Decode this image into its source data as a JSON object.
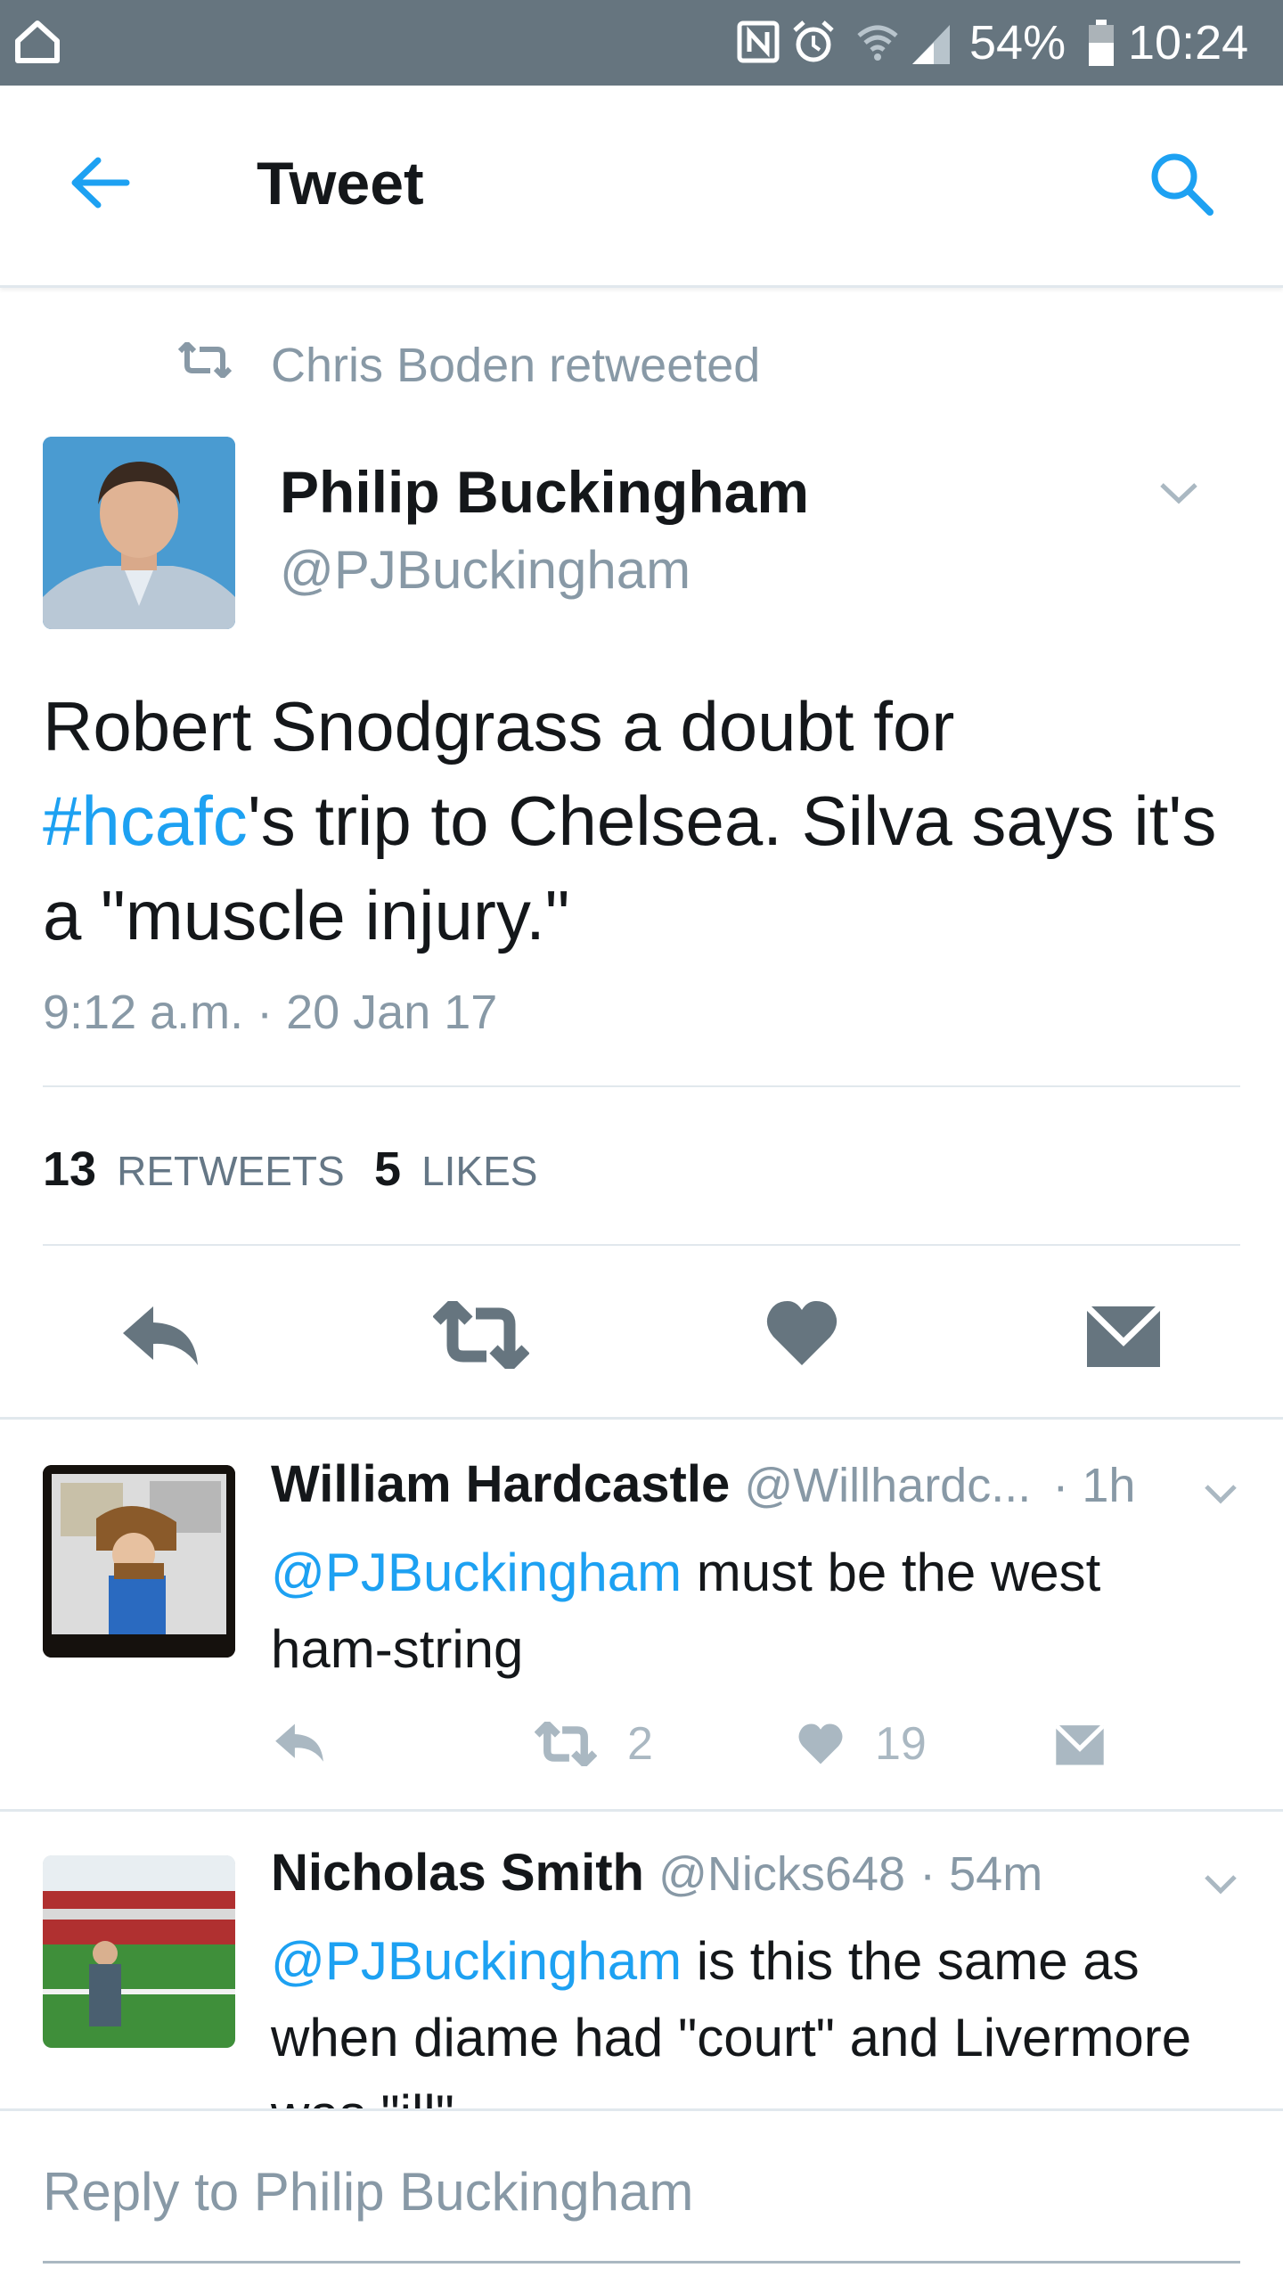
{
  "status_bar": {
    "battery": "54%",
    "time": "10:24",
    "icons": [
      "home-outline-icon",
      "nfc-icon",
      "alarm-icon",
      "wifi-icon",
      "signal-icon",
      "battery-icon"
    ]
  },
  "header": {
    "title": "Tweet",
    "back_icon": "back-arrow-icon",
    "search_icon": "search-icon"
  },
  "main_tweet": {
    "retweeted_by": "Chris Boden retweeted",
    "author_name": "Philip Buckingham",
    "author_handle": "@PJBuckingham",
    "text_line1": "Robert Snodgrass a doubt for",
    "hashtag": "#hcafc",
    "text_line2_rest": "'s trip to Chelsea. Silva says it's",
    "text_line3": "a \"muscle injury.\"",
    "timestamp": "9:12 a.m. · 20 Jan 17",
    "retweets_count": "13",
    "retweets_label": "RETWEETS",
    "likes_count": "5",
    "likes_label": "LIKES"
  },
  "replies": [
    {
      "name": "William Hardcastle",
      "handle": "@Willhardc...",
      "time": "· 1h",
      "mention": "@PJBuckingham",
      "text_rest": " must be the west",
      "text_line2": "ham-string",
      "retweets": "2",
      "likes": "19"
    },
    {
      "name": "Nicholas Smith",
      "handle": "@Nicks648",
      "time": "· 54m",
      "mention": "@PJBuckingham",
      "text_rest": " is this the same as",
      "text_line2": "when diame had \"court\" and Livermore",
      "text_line3": "was \"ill\""
    }
  ],
  "reply_bar": {
    "placeholder": "Reply to Philip Buckingham"
  },
  "colors": {
    "accent": "#1da1f2",
    "status_bar": "#66757f",
    "action_icons": "#66757f",
    "muted_text": "#8899a6"
  }
}
